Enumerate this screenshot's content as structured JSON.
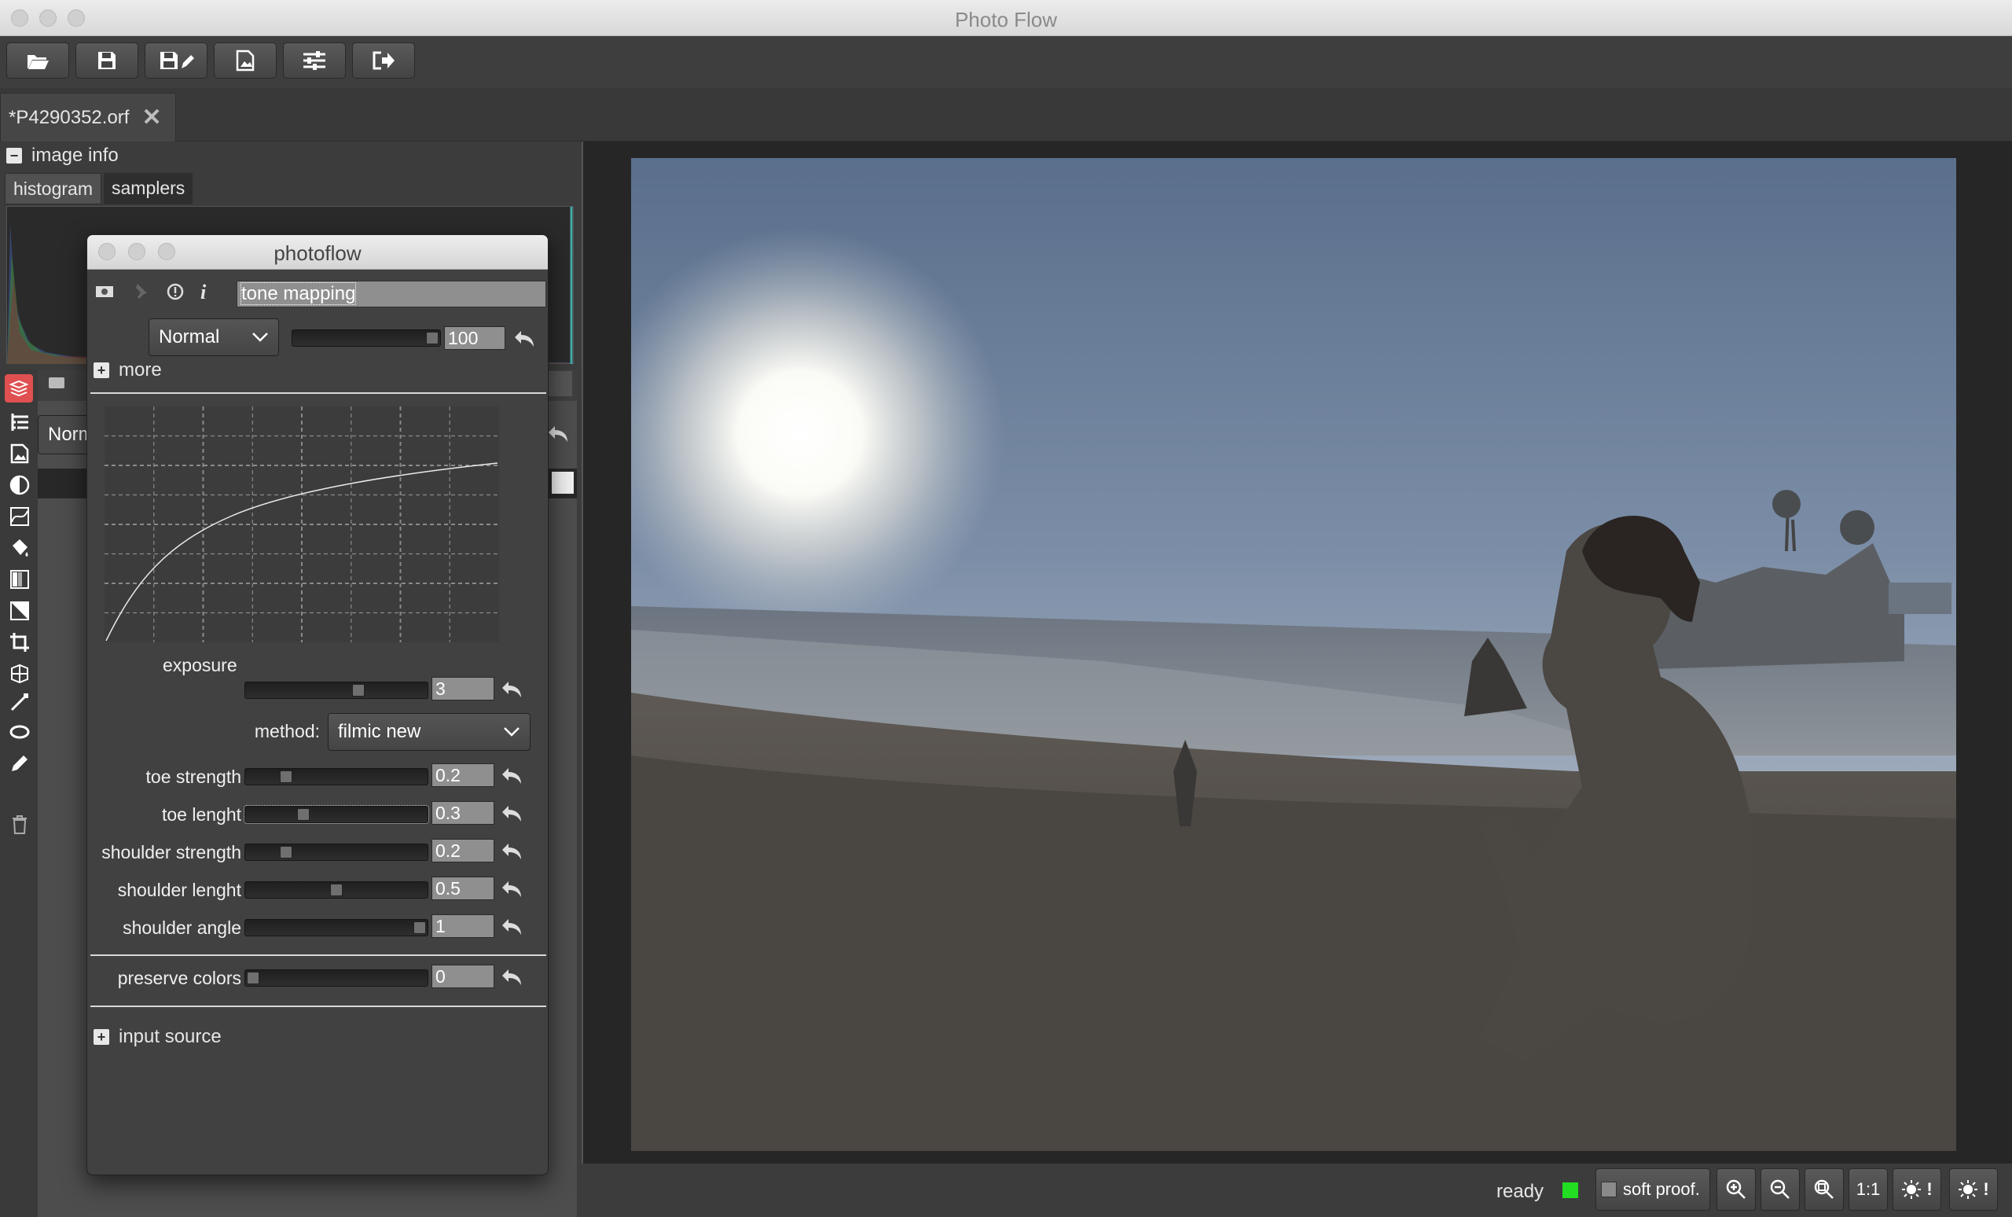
{
  "window": {
    "title": "Photo Flow"
  },
  "toolbar": {
    "icons": [
      "folder-open-icon",
      "save-icon",
      "save-as-icon",
      "export-image-icon",
      "settings-sliders-icon",
      "exit-icon"
    ]
  },
  "file_tab": {
    "label": "*P4290352.orf",
    "close": "✕"
  },
  "image_info": {
    "label": "image info",
    "tabs": [
      "histogram",
      "samplers"
    ]
  },
  "layers": {
    "blend_mode_partial": "Norm"
  },
  "dialog": {
    "title": "photoflow",
    "layer_name": "tone mapping",
    "blend_mode": "Normal",
    "opacity": "100",
    "more_label": "more",
    "exposure": {
      "label": "exposure",
      "value": "3"
    },
    "method": {
      "label": "method:",
      "value": "filmic new"
    },
    "params": [
      {
        "label": "toe strength",
        "value": "0.2",
        "level": 0.2
      },
      {
        "label": "toe lenght",
        "value": "0.3",
        "level": 0.3
      },
      {
        "label": "shoulder strength",
        "value": "0.2",
        "level": 0.2
      },
      {
        "label": "shoulder lenght",
        "value": "0.5",
        "level": 0.5
      },
      {
        "label": "shoulder angle",
        "value": "1",
        "level": 1.0
      }
    ],
    "preserve_colors": {
      "label": "preserve colors",
      "value": "0"
    },
    "input_source_label": "input source"
  },
  "status": {
    "text": "ready",
    "indicator_color": "#22dd22",
    "soft_proof_label": "soft proof.",
    "one_to_one": "1:1",
    "warn": "!"
  },
  "colors": {
    "accent_layers_icon": "#e05050",
    "panel_bg": "#3c3c3c"
  }
}
